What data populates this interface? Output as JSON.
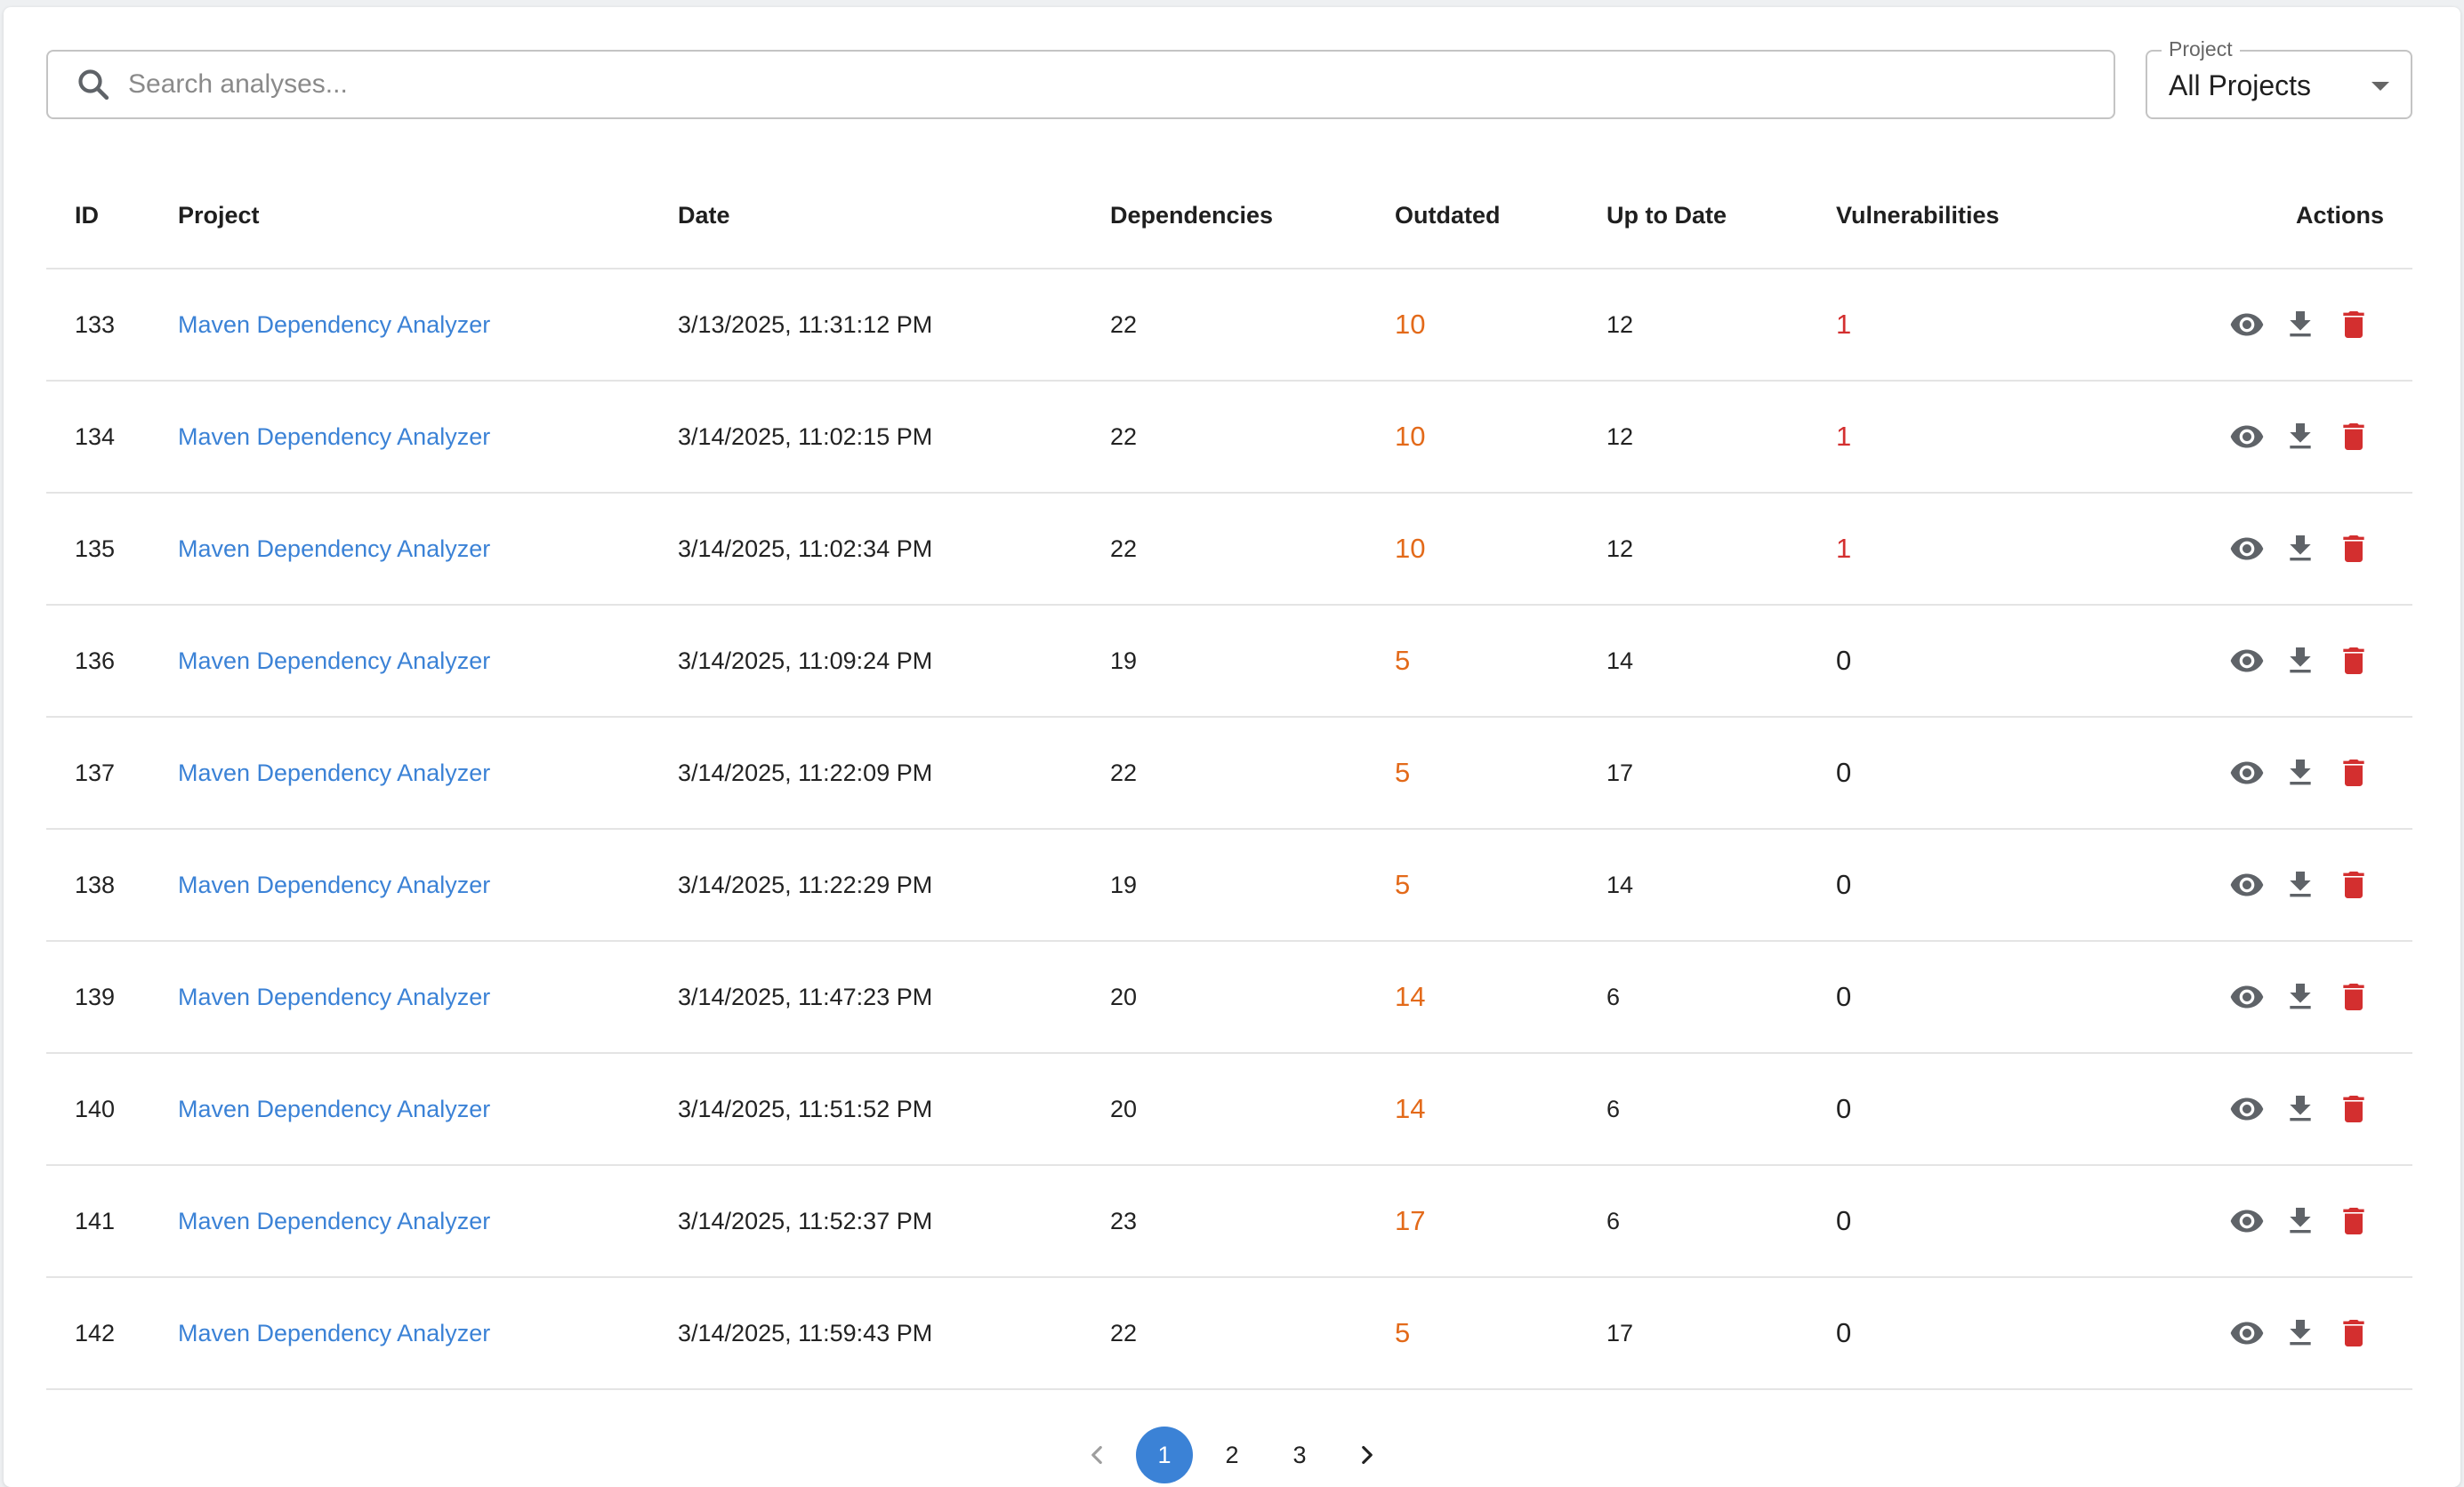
{
  "search": {
    "placeholder": "Search analyses..."
  },
  "project_filter": {
    "label": "Project",
    "value": "All Projects"
  },
  "table": {
    "headers": {
      "id": "ID",
      "project": "Project",
      "date": "Date",
      "dependencies": "Dependencies",
      "outdated": "Outdated",
      "up_to_date": "Up to Date",
      "vulnerabilities": "Vulnerabilities",
      "actions": "Actions"
    },
    "rows": [
      {
        "id": "133",
        "project": "Maven Dependency Analyzer",
        "date": "3/13/2025, 11:31:12 PM",
        "dependencies": "22",
        "outdated": "10",
        "up_to_date": "12",
        "vulnerabilities": "1"
      },
      {
        "id": "134",
        "project": "Maven Dependency Analyzer",
        "date": "3/14/2025, 11:02:15 PM",
        "dependencies": "22",
        "outdated": "10",
        "up_to_date": "12",
        "vulnerabilities": "1"
      },
      {
        "id": "135",
        "project": "Maven Dependency Analyzer",
        "date": "3/14/2025, 11:02:34 PM",
        "dependencies": "22",
        "outdated": "10",
        "up_to_date": "12",
        "vulnerabilities": "1"
      },
      {
        "id": "136",
        "project": "Maven Dependency Analyzer",
        "date": "3/14/2025, 11:09:24 PM",
        "dependencies": "19",
        "outdated": "5",
        "up_to_date": "14",
        "vulnerabilities": "0"
      },
      {
        "id": "137",
        "project": "Maven Dependency Analyzer",
        "date": "3/14/2025, 11:22:09 PM",
        "dependencies": "22",
        "outdated": "5",
        "up_to_date": "17",
        "vulnerabilities": "0"
      },
      {
        "id": "138",
        "project": "Maven Dependency Analyzer",
        "date": "3/14/2025, 11:22:29 PM",
        "dependencies": "19",
        "outdated": "5",
        "up_to_date": "14",
        "vulnerabilities": "0"
      },
      {
        "id": "139",
        "project": "Maven Dependency Analyzer",
        "date": "3/14/2025, 11:47:23 PM",
        "dependencies": "20",
        "outdated": "14",
        "up_to_date": "6",
        "vulnerabilities": "0"
      },
      {
        "id": "140",
        "project": "Maven Dependency Analyzer",
        "date": "3/14/2025, 11:51:52 PM",
        "dependencies": "20",
        "outdated": "14",
        "up_to_date": "6",
        "vulnerabilities": "0"
      },
      {
        "id": "141",
        "project": "Maven Dependency Analyzer",
        "date": "3/14/2025, 11:52:37 PM",
        "dependencies": "23",
        "outdated": "17",
        "up_to_date": "6",
        "vulnerabilities": "0"
      },
      {
        "id": "142",
        "project": "Maven Dependency Analyzer",
        "date": "3/14/2025, 11:59:43 PM",
        "dependencies": "22",
        "outdated": "5",
        "up_to_date": "17",
        "vulnerabilities": "0"
      }
    ],
    "row_actions": [
      "eye-icon",
      "download-icon",
      "delete-icon"
    ]
  },
  "pagination": {
    "pages": [
      "1",
      "2",
      "3"
    ],
    "current_page": "1"
  },
  "colors": {
    "link": "#3b82d6",
    "outdated": "#e36a1a",
    "vulnerable": "#d32f2f",
    "action_icon": "#5f6368",
    "delete_icon": "#d32f2f",
    "page_active": "#3b82d6"
  }
}
